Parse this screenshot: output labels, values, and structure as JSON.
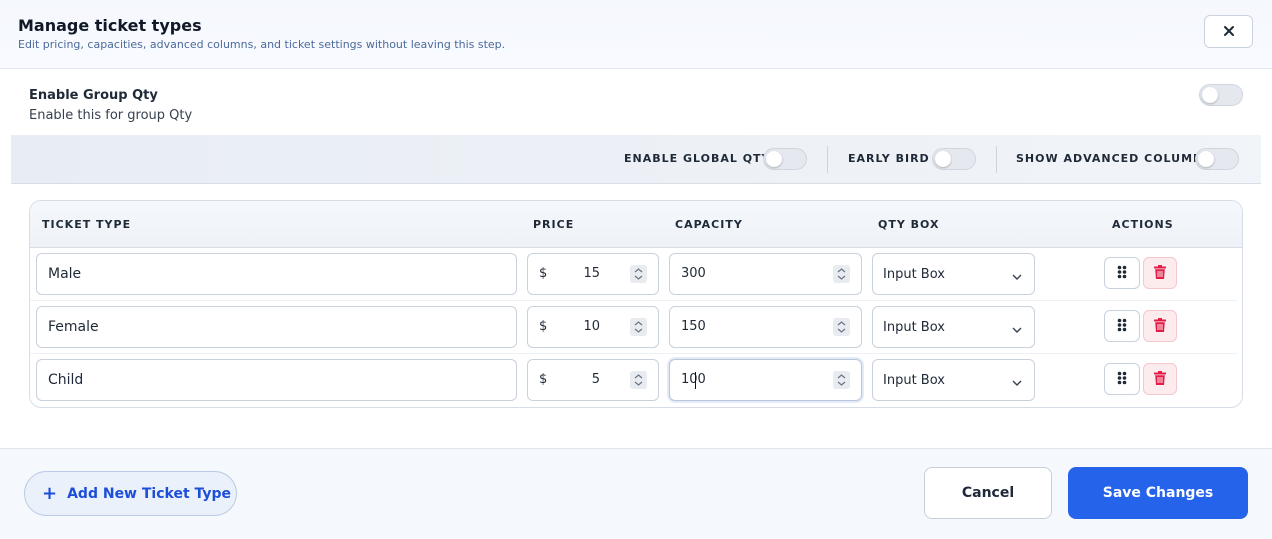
{
  "dialog": {
    "title": "Manage ticket types",
    "subtitle": "Edit pricing, capacities, advanced columns, and ticket settings without leaving this step.",
    "close_icon": "close-icon"
  },
  "group_qty": {
    "title": "Enable Group Qty",
    "description": "Enable this for group Qty",
    "enabled": false
  },
  "options": {
    "global_qty": {
      "label": "ENABLE GLOBAL QTY",
      "enabled": false
    },
    "early_bird": {
      "label": "EARLY BIRD",
      "enabled": false
    },
    "advanced_column": {
      "label": "SHOW ADVANCED COLUMN",
      "enabled": false
    }
  },
  "table": {
    "headers": {
      "ticket_type": "TICKET TYPE",
      "price": "PRICE",
      "capacity": "CAPACITY",
      "qty_box": "QTY BOX",
      "actions": "ACTIONS"
    },
    "rows": [
      {
        "name": "Male",
        "currency": "$",
        "price": "15",
        "capacity": "300",
        "qty_box": "Input Box"
      },
      {
        "name": "Female",
        "currency": "$",
        "price": "10",
        "capacity": "150",
        "qty_box": "Input Box"
      },
      {
        "name": "Child",
        "currency": "$",
        "price": "5",
        "capacity": "100",
        "qty_box": "Input Box"
      }
    ]
  },
  "footer": {
    "add_label": "Add New Ticket Type",
    "cancel_label": "Cancel",
    "save_label": "Save Changes"
  },
  "colors": {
    "primary": "#2563eb",
    "primary_text": "#1d4ed8",
    "danger": "#e11d48",
    "danger_bg": "#fdecee"
  }
}
